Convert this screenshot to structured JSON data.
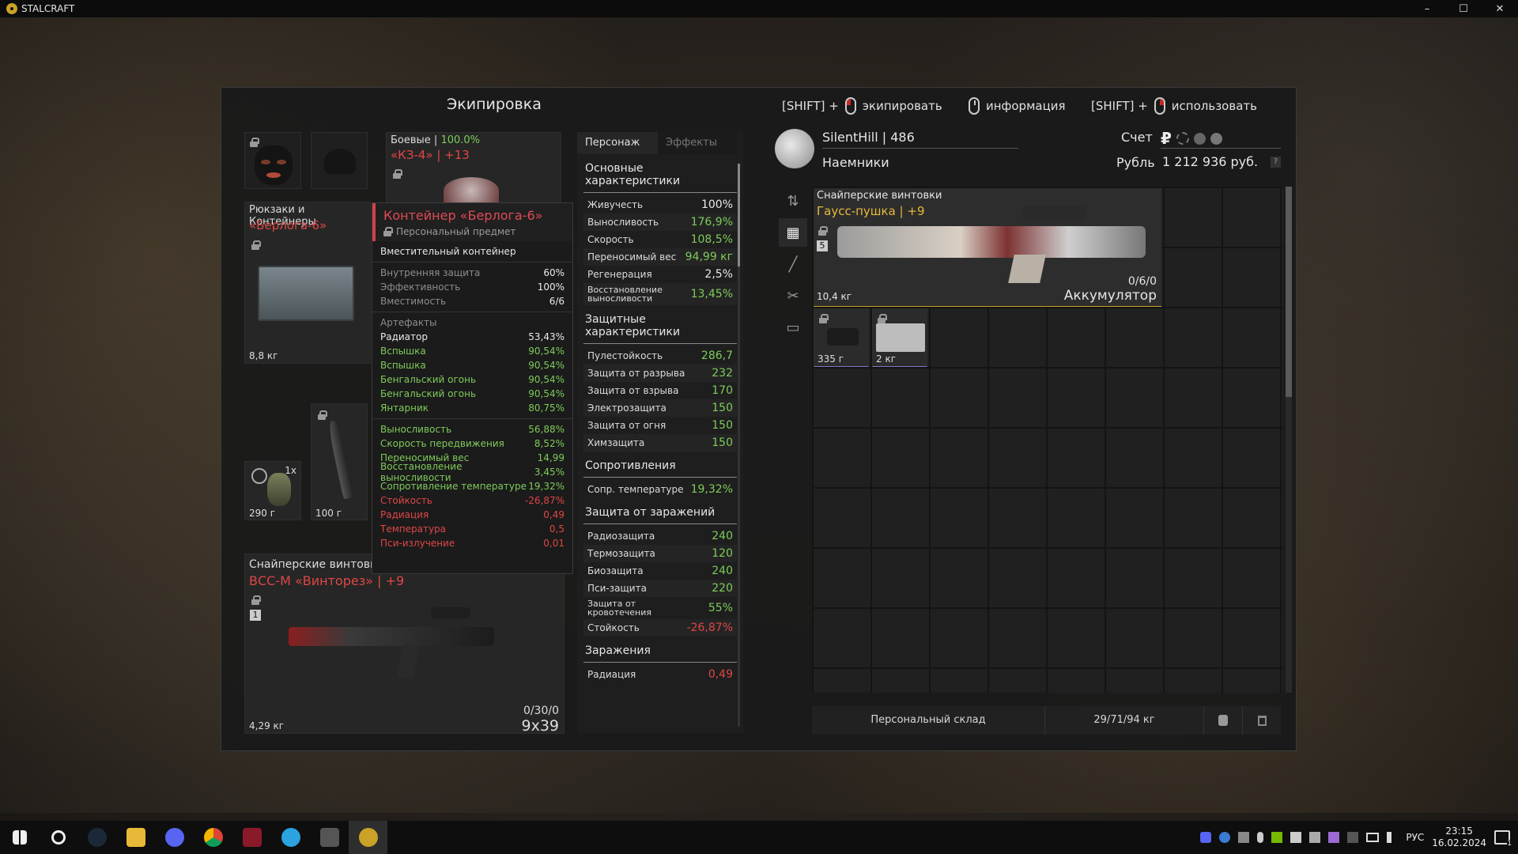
{
  "window": {
    "title": "STALCRAFT",
    "minimize": "–",
    "maximize": "☐",
    "close": "✕"
  },
  "panel": {
    "title": "Экипировка",
    "hints": [
      {
        "prefix": "[SHIFT] +",
        "label": "экипировать"
      },
      {
        "prefix": "",
        "label": "информация"
      },
      {
        "prefix": "[SHIFT] +",
        "label": "использовать"
      }
    ]
  },
  "equipment": {
    "armor": {
      "category": "Боевые",
      "percent": "100.0%",
      "name": "«КЗ-4» | +13"
    },
    "backpack": {
      "category": "Рюкзаки и Контейнеры",
      "name": "«Берлога-6»",
      "weight": "8,8 кг"
    },
    "grenade": {
      "count": "1x",
      "weight": "290 г"
    },
    "knife": {
      "weight": "100 г"
    },
    "weapon": {
      "category": "Снайперские винтовки",
      "name": "ВСС-М «Винторез» | +9",
      "slot": "1",
      "weight": "4,29 кг",
      "ammo": "0/30/0",
      "caliber": "9x39"
    }
  },
  "tooltip": {
    "title": "Контейнер «Берлога-6»",
    "subtitle": "Персональный предмет",
    "description": "Вместительный контейнер",
    "props": [
      {
        "k": "Внутренняя защита",
        "v": "60%"
      },
      {
        "k": "Эффективность",
        "v": "100%"
      },
      {
        "k": "Вместимость",
        "v": "6/6"
      }
    ],
    "artifacts_label": "Артефакты",
    "artifacts": [
      {
        "k": "Радиатор",
        "v": "53,43%",
        "c": "#eaeaea"
      },
      {
        "k": "Вспышка",
        "v": "90,54%",
        "c": "#7ecb5a"
      },
      {
        "k": "Вспышка",
        "v": "90,54%",
        "c": "#7ecb5a"
      },
      {
        "k": "Бенгальский огонь",
        "v": "90,54%",
        "c": "#7ecb5a"
      },
      {
        "k": "Бенгальский огонь",
        "v": "90,54%",
        "c": "#7ecb5a"
      },
      {
        "k": "Янтарник",
        "v": "80,75%",
        "c": "#7ecb5a"
      }
    ],
    "effects": [
      {
        "k": "Выносливость",
        "v": "56,88%",
        "c": "#7ecb5a"
      },
      {
        "k": "Скорость передвижения",
        "v": "8,52%",
        "c": "#7ecb5a"
      },
      {
        "k": "Переносимый вес",
        "v": "14,99",
        "c": "#7ecb5a"
      },
      {
        "k": "Восстановление выносливости",
        "v": "3,45%",
        "c": "#7ecb5a"
      },
      {
        "k": "Сопротивление температуре",
        "v": "19,32%",
        "c": "#7ecb5a"
      },
      {
        "k": "Стойкость",
        "v": "-26,87%",
        "c": "#e04646"
      },
      {
        "k": "Радиация",
        "v": "0,49",
        "c": "#e04646"
      },
      {
        "k": "Температура",
        "v": "0,5",
        "c": "#e04646"
      },
      {
        "k": "Пси-излучение",
        "v": "0,01",
        "c": "#e04646"
      }
    ]
  },
  "stats": {
    "tabs": [
      "Персонаж",
      "Эффекты"
    ],
    "sections": [
      {
        "title": "Основные характеристики",
        "rows": [
          {
            "k": "Живучесть",
            "v": "100%",
            "c": "#eaeaea"
          },
          {
            "k": "Выносливость",
            "v": "176,9%",
            "c": "#7ecb5a"
          },
          {
            "k": "Скорость",
            "v": "108,5%",
            "c": "#7ecb5a"
          },
          {
            "k": "Переносимый вес",
            "v": "94,99 кг",
            "c": "#7ecb5a"
          },
          {
            "k": "Регенерация",
            "v": "2,5%",
            "c": "#eaeaea"
          },
          {
            "k": "Восстановление выносливости",
            "v": "13,45%",
            "c": "#7ecb5a"
          }
        ]
      },
      {
        "title": "Защитные характеристики",
        "rows": [
          {
            "k": "Пулестойкость",
            "v": "286,7",
            "c": "#7ecb5a"
          },
          {
            "k": "Защита от разрыва",
            "v": "232",
            "c": "#7ecb5a"
          },
          {
            "k": "Защита от взрыва",
            "v": "170",
            "c": "#7ecb5a"
          },
          {
            "k": "Электрозащита",
            "v": "150",
            "c": "#7ecb5a"
          },
          {
            "k": "Защита от огня",
            "v": "150",
            "c": "#7ecb5a"
          },
          {
            "k": "Химзащита",
            "v": "150",
            "c": "#7ecb5a"
          }
        ]
      },
      {
        "title": "Сопротивления",
        "rows": [
          {
            "k": "Сопр. температуре",
            "v": "19,32%",
            "c": "#7ecb5a"
          }
        ]
      },
      {
        "title": "Защита от заражений",
        "rows": [
          {
            "k": "Радиозащита",
            "v": "240",
            "c": "#7ecb5a"
          },
          {
            "k": "Термозащита",
            "v": "120",
            "c": "#7ecb5a"
          },
          {
            "k": "Биозащита",
            "v": "240",
            "c": "#7ecb5a"
          },
          {
            "k": "Пси-защита",
            "v": "220",
            "c": "#7ecb5a"
          },
          {
            "k": "Защита от кровотечения",
            "v": "55%",
            "c": "#7ecb5a"
          },
          {
            "k": "Стойкость",
            "v": "-26,87%",
            "c": "#e04646"
          }
        ]
      },
      {
        "title": "Заражения",
        "rows": [
          {
            "k": "Радиация",
            "v": "0,49",
            "c": "#e04646"
          }
        ]
      }
    ]
  },
  "player": {
    "name": "SilentHill | 486",
    "faction": "Наемники",
    "account_label": "Счет",
    "currency_label": "Рубль",
    "balance": "1 212 936 руб.",
    "help": "?"
  },
  "inventory": {
    "item": {
      "category": "Снайперские винтовки",
      "name": "Гаусс-пушка | +9",
      "slot": "5",
      "weight": "10,4 кг",
      "ammo": "0/6/0",
      "ammo_type": "Аккумулятор"
    },
    "small_items": [
      {
        "weight": "335 г"
      },
      {
        "weight": "2 кг"
      }
    ],
    "storage_label": "Персональный склад",
    "capacity": "29/71/94 кг"
  },
  "taskbar": {
    "lang": "РУС",
    "time": "23:15",
    "date": "16.02.2024",
    "notifications": "1"
  }
}
